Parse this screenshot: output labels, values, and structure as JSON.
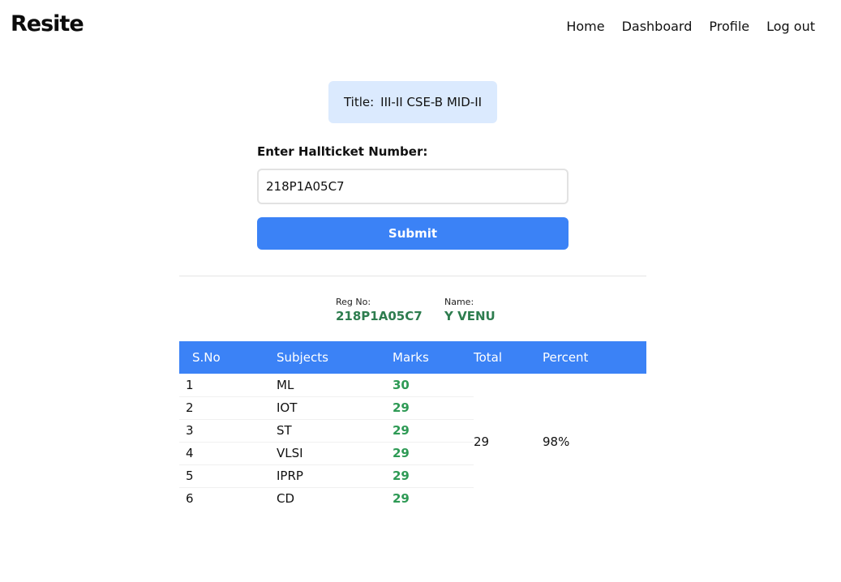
{
  "nav": {
    "brand": "Resite",
    "links": [
      "Home",
      "Dashboard",
      "Profile",
      "Log out"
    ]
  },
  "exam": {
    "title_label": "Title:",
    "title_value": "III-II CSE-B MID-II"
  },
  "form": {
    "label": "Enter Hallticket Number:",
    "hallticket_value": "218P1A05C7",
    "submit_label": "Submit"
  },
  "student": {
    "reg_label": "Reg No:",
    "reg_value": "218P1A05C7",
    "name_label": "Name:",
    "name_value": "Y VENU"
  },
  "table": {
    "headers": [
      "S.No",
      "Subjects",
      "Marks",
      "Total",
      "Percent"
    ],
    "rows": [
      {
        "sno": "1",
        "subject": "ML",
        "marks": "30"
      },
      {
        "sno": "2",
        "subject": "IOT",
        "marks": "29"
      },
      {
        "sno": "3",
        "subject": "ST",
        "marks": "29"
      },
      {
        "sno": "4",
        "subject": "VLSI",
        "marks": "29"
      },
      {
        "sno": "5",
        "subject": "IPRP",
        "marks": "29"
      },
      {
        "sno": "6",
        "subject": "CD",
        "marks": "29"
      }
    ],
    "total": "29",
    "percent": "98%"
  },
  "colors": {
    "primary": "#3b82f6",
    "title_bg": "#dbeafe",
    "success": "#2e7d4f",
    "marks": "#2e9a55"
  }
}
